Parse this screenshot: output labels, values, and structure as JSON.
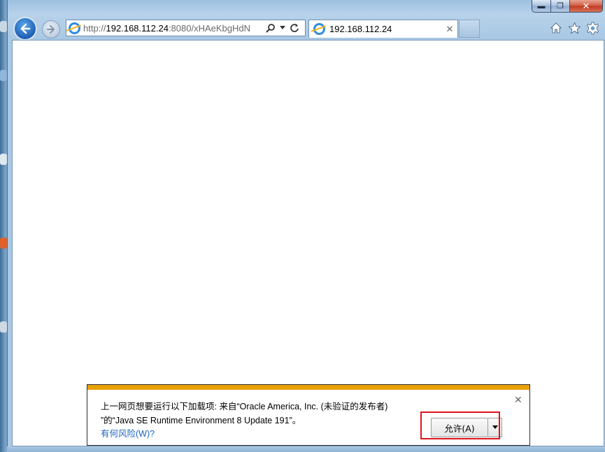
{
  "browser": {
    "address": {
      "url_prefix": "http://",
      "url_host": "192.168.112.24",
      "url_rest": ":8080/xHAeKbgHdN"
    },
    "tab": {
      "title": "192.168.112.24",
      "close_glyph": "✕"
    },
    "caption": {
      "minimize_glyph": "▬",
      "maximize_glyph": "❐",
      "close_glyph": "✕"
    },
    "tools": {
      "home_icon": "home-icon",
      "favorites_icon": "star-icon",
      "settings_icon": "gear-icon"
    }
  },
  "notification": {
    "line1": "上一网页想要运行以下加载项: 来自“Oracle America, Inc. (未验证的发布者)",
    "line2": "”的“Java SE Runtime Environment 8 Update 191”。",
    "risk_link": "有何风险(W)?",
    "allow_button": "允许(A)",
    "close_glyph": "✕",
    "accent_color": "#e8a200",
    "highlight_color": "#e0141e"
  }
}
